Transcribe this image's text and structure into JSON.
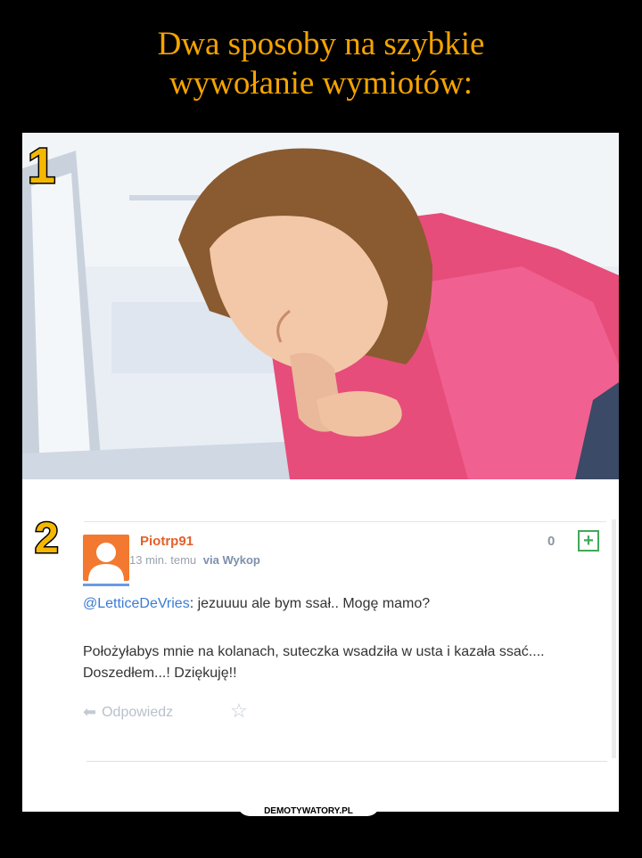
{
  "title": {
    "line1": "Dwa sposoby na szybkie",
    "line2": "wywołanie wymiotów:"
  },
  "markers": {
    "first": "1",
    "second": "2"
  },
  "comment": {
    "username": "Piotrp91",
    "time": "13 min. temu",
    "via": "via Wykop",
    "score": "0",
    "plus": "+",
    "mention": "@LetticeDeVries",
    "line1_rest": ": jezuuuu ale bym ssał.. Mogę mamo?",
    "line2": "Położyłabys mnie na kolanach, suteczka wsadziła w usta i kazała ssać.... Doszedłem...! Dziękuję!!",
    "reply_label": "Odpowiedz"
  },
  "watermark": "DEMOTYWATORY.PL",
  "colors": {
    "title": "#f5a300",
    "username": "#e4602a",
    "mention": "#3a7bd5",
    "avatar": "#f2792f",
    "plus": "#43a85a"
  },
  "icons": {
    "reply": "reply-arrow-icon",
    "star": "star-icon",
    "plus": "plus-box-icon",
    "avatar": "user-avatar-icon"
  }
}
